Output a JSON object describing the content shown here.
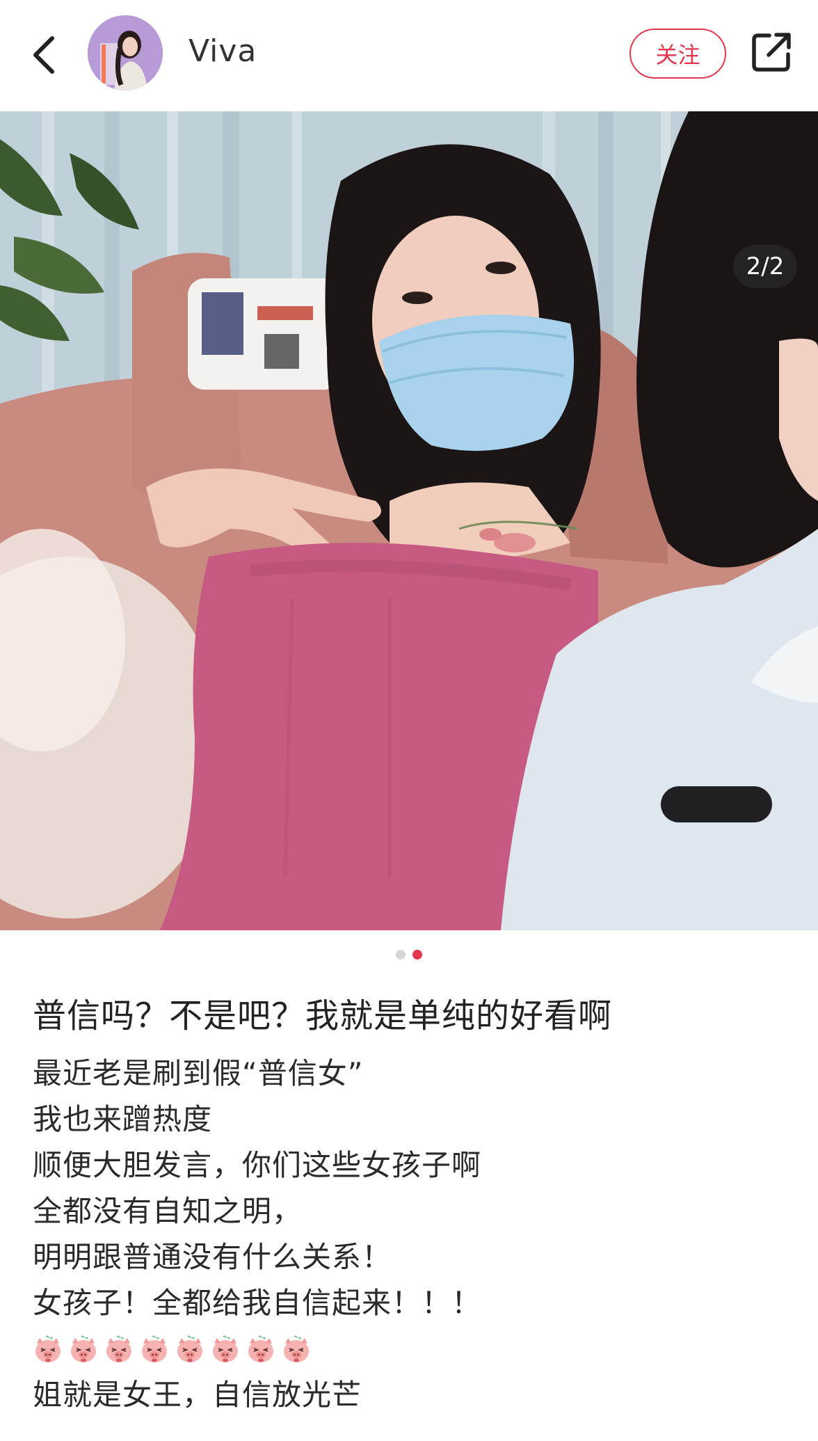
{
  "header": {
    "back_icon": "chevron-left-icon",
    "username": "Viva",
    "follow_label": "关注",
    "share_icon": "share-external-icon"
  },
  "photo": {
    "counter": "2/2",
    "pages_total": 2,
    "current_page": 2
  },
  "post": {
    "title": "普信吗？不是吧？我就是单纯的好看啊",
    "lines": [
      "最近老是刷到假“普信女”",
      "我也来蹭热度",
      "顺便大胆发言，你们这些女孩子啊",
      "全都没有自知之明，",
      "明明跟普通没有什么关系！",
      "女孩子！全都给我自信起来！！！"
    ],
    "emoji_icon": "pig-face-emoji-icon",
    "emoji_count": 8,
    "last_line": "姐就是女王，自信放光芒"
  },
  "colors": {
    "accent": "#e2374d",
    "dot_inactive": "#d6d6d6",
    "counter_bg": "#282828"
  }
}
